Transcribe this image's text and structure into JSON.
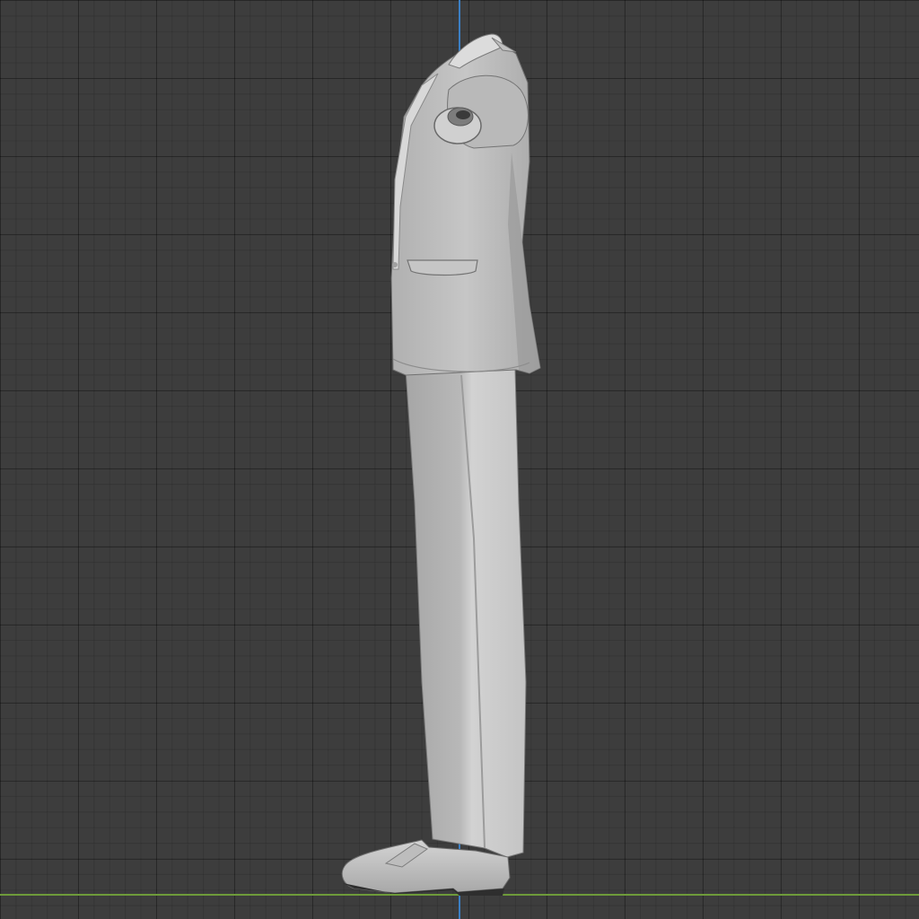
{
  "viewport": {
    "background_color": "#3d3d3d",
    "axis_z_color": "#3b7fc4",
    "axis_y_color": "#6e9b3a"
  },
  "model": {
    "icon": "suit-mannequin-side-view",
    "shade_light": "#c9c9c9",
    "shade_mid": "#b4b4b4",
    "shade_dark": "#8e8e8e",
    "outline": "#6e6e6e"
  }
}
